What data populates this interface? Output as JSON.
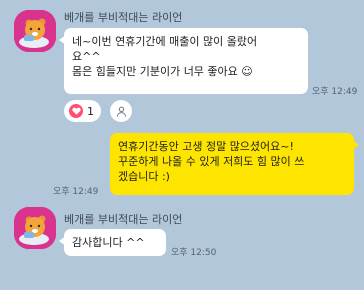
{
  "colors": {
    "background": "#b2c7da",
    "incoming_bubble": "#ffffff",
    "outgoing_bubble": "#fee500",
    "reaction_heart": "#ff4f6f",
    "avatar_bg": "#d9328f"
  },
  "messages": [
    {
      "sender": "베개를 부비적대는 라이언",
      "lines": [
        "네~이번 연휴기간에 매출이 많이 올랐어",
        "요^^",
        "몸은 힘들지만 기분이가 너무 좋아요 ☺"
      ],
      "time": "오후 12:49",
      "reaction": {
        "icon": "heart-icon",
        "count": "1"
      }
    },
    {
      "lines": [
        "연휴기간동안 고생 정말 많으셨어요~!",
        "꾸준하게 나올 수 있게 저희도 힘 많이 쓰",
        "겠습니다 :)"
      ],
      "time": "오후 12:49"
    },
    {
      "sender": "베개를 부비적대는 라이언",
      "lines": [
        "감사합니다 ^^"
      ],
      "time": "오후 12:50"
    }
  ]
}
